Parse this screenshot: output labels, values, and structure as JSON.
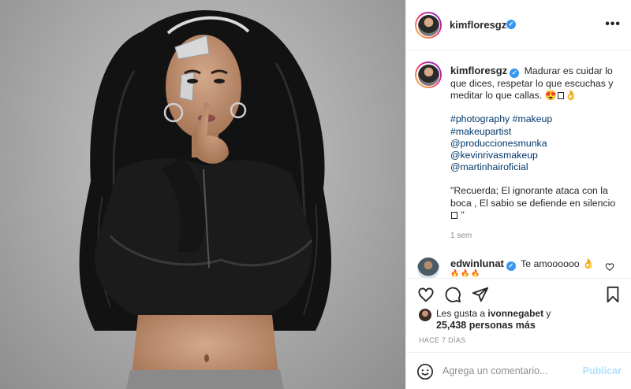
{
  "colors": {
    "accent": "#3897f0",
    "link": "#00376b",
    "muted": "#8e8e8e",
    "publish_disabled": "#b2dffc"
  },
  "photo": {
    "alt_hint": "portrait"
  },
  "header": {
    "username": "kimfloresgz",
    "more_label": "•••"
  },
  "caption": {
    "username": "kimfloresgz",
    "text": "Madurar es cuidar lo que dices, respetar lo que escuchas y meditar lo que callas. 😍",
    "emoji_tail": "👌",
    "tags": [
      "#photography",
      "#makeup",
      "#makeupartist"
    ],
    "mentions": [
      "@produccionesmunka",
      "@kevinrivasmakeup",
      "@martinhairoficial"
    ],
    "quote": "\"Recuerda; El ignorante ataca con la boca , El sabio se defiende en silencio",
    "quote_end": " \"",
    "time": "1 sem"
  },
  "reply": {
    "username": "edwinlunat",
    "text": "Te amoooooo",
    "emoji": "👌",
    "fires": "🔥🔥🔥"
  },
  "likes": {
    "prefix": "Les gusta a",
    "user": "ivonnegabet",
    "conj": "y",
    "count_text": "25,438 personas más"
  },
  "date": "HACE 7 DÍAS",
  "comment_box": {
    "placeholder": "Agrega un comentario...",
    "publish": "Publicar"
  },
  "icons": [
    "heart-icon",
    "comment-icon",
    "share-icon",
    "bookmark-icon",
    "smile-icon",
    "verified-icon",
    "more-icon"
  ]
}
